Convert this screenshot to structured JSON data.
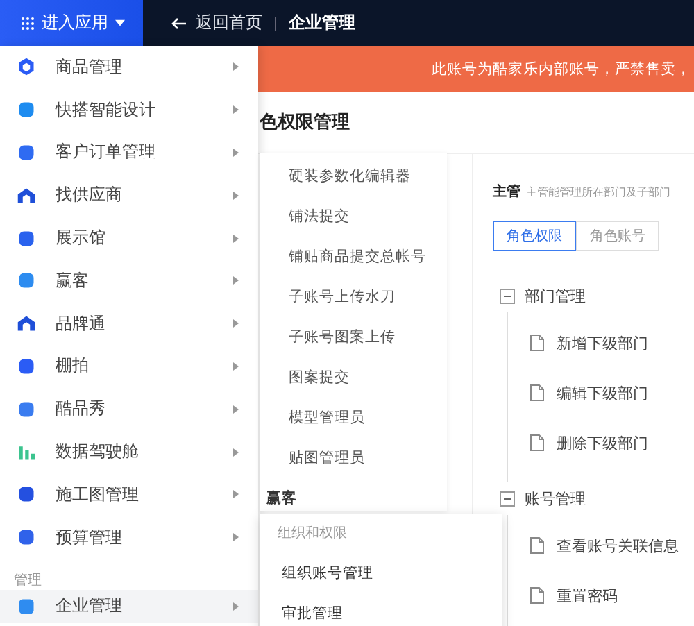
{
  "top_bar": {
    "app_button": "进入应用",
    "back_link": "返回首页",
    "current": "企业管理"
  },
  "banner": "此账号为酷家乐内部账号，严禁售卖，",
  "page_title": "色权限管理",
  "role": {
    "name": "主管",
    "description": "主管能管理所在部门及子部门"
  },
  "role_tabs": [
    {
      "label": "角色权限",
      "selected": true
    },
    {
      "label": "角色账号",
      "selected": false
    }
  ],
  "tree": [
    {
      "label": "部门管理",
      "expanded": true,
      "children": [
        {
          "label": "新增下级部门"
        },
        {
          "label": "编辑下级部门"
        },
        {
          "label": "删除下级部门"
        }
      ]
    },
    {
      "label": "账号管理",
      "expanded": true,
      "children": [
        {
          "label": "查看账号关联信息"
        },
        {
          "label": "重置密码"
        }
      ]
    }
  ],
  "app_menu": {
    "items": [
      {
        "label": "商品管理",
        "selected": false
      },
      {
        "label": "快搭智能设计",
        "selected": false
      },
      {
        "label": "客户订单管理",
        "selected": false
      },
      {
        "label": "找供应商",
        "selected": false
      },
      {
        "label": "展示馆",
        "selected": false
      },
      {
        "label": "赢客",
        "selected": false
      },
      {
        "label": "品牌通",
        "selected": false
      },
      {
        "label": "棚拍",
        "selected": false
      },
      {
        "label": "酷品秀",
        "selected": false
      },
      {
        "label": "数据驾驶舱",
        "selected": false
      },
      {
        "label": "施工图管理",
        "selected": false
      },
      {
        "label": "预算管理",
        "selected": false
      }
    ],
    "section": "管理",
    "section_items": [
      {
        "label": "企业管理",
        "selected": true
      }
    ]
  },
  "submenu": {
    "items": [
      "硬装参数化编辑器",
      "铺法提交",
      "铺贴商品提交总帐号",
      "子账号上传水刀",
      "子账号图案上传",
      "图案提交",
      "模型管理员",
      "贴图管理员"
    ],
    "group": "赢客"
  },
  "popup": {
    "header": "组织和权限",
    "items": [
      "组织账号管理",
      "审批管理"
    ]
  }
}
